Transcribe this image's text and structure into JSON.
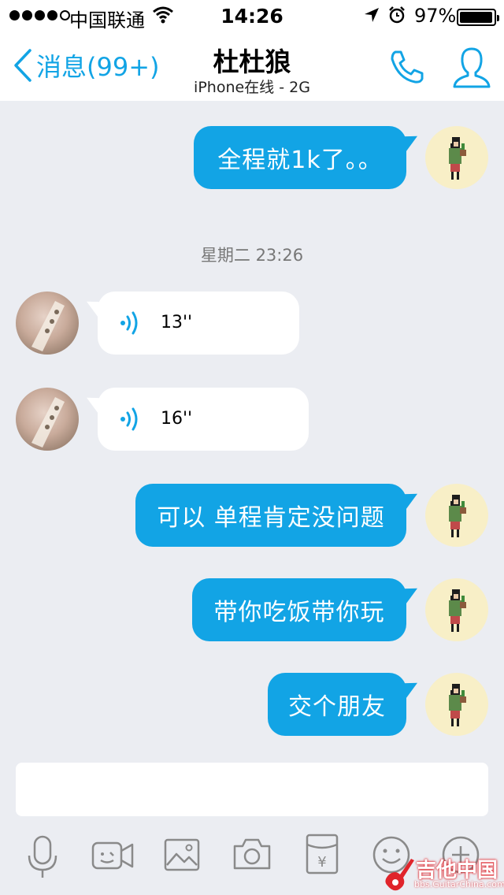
{
  "status_bar": {
    "carrier": "中国联通",
    "time": "14:26",
    "battery": "97%",
    "battery_level": 0.97
  },
  "nav": {
    "back_label": "消息(99+)",
    "title": "杜杜狼",
    "subtitle": "iPhone在线 - 2G"
  },
  "messages": {
    "m1": "全程就1k了。。",
    "timestamp": "星期二 23:26",
    "voice1": "13''",
    "voice2": "16''",
    "m2": "可以 单程肯定没问题",
    "m3": "带你吃饭带你玩",
    "m4": "交个朋友"
  },
  "input": {
    "placeholder": ""
  },
  "toolbar": [
    "mic-icon",
    "video-icon",
    "image-icon",
    "camera-icon",
    "red-packet-icon",
    "emoji-icon",
    "plus-icon"
  ],
  "watermark": {
    "title": "吉他中国",
    "url": "bbs.GuitarChina.com"
  },
  "colors": {
    "accent": "#12a4e5",
    "background": "#ebedf2",
    "avatar_bg": "#f8efc7",
    "watermark_red": "#e0242b"
  }
}
